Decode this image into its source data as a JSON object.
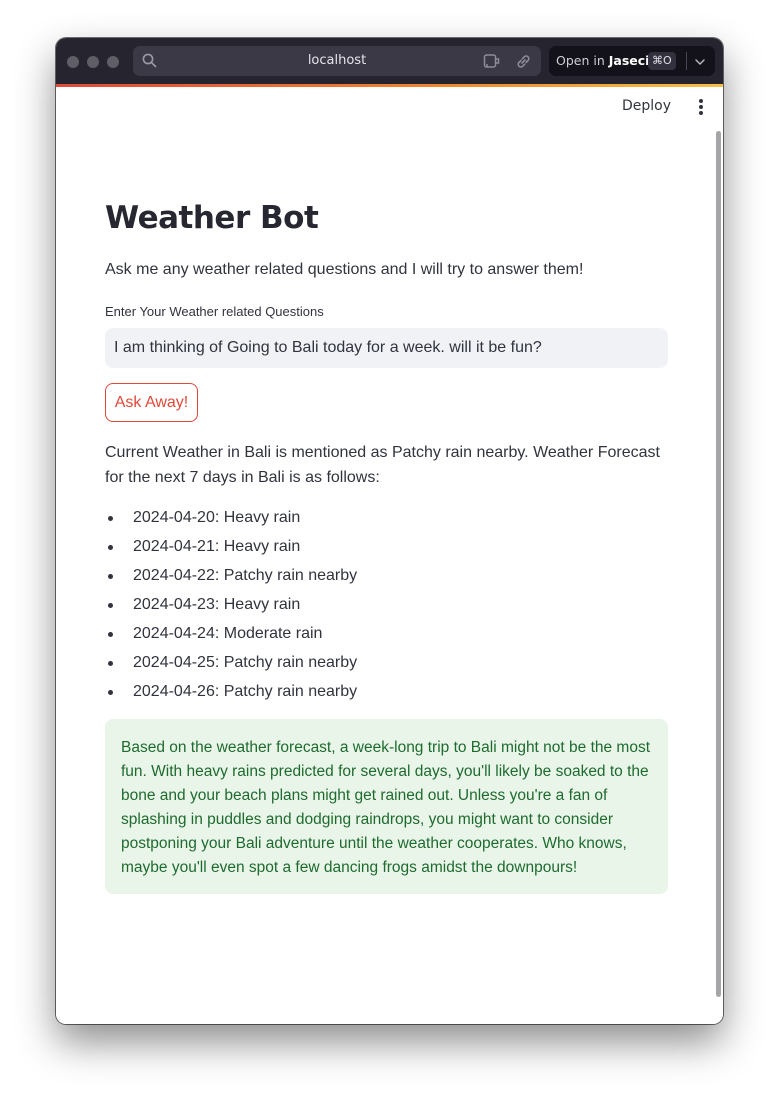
{
  "browser": {
    "url": "localhost",
    "open_in_label": "Open in",
    "open_in_brand": "Jaseci",
    "open_in_shortcut": "⌘O"
  },
  "app": {
    "deploy_label": "Deploy",
    "title": "Weather Bot",
    "subtitle": "Ask me any weather related questions and I will try to answer them!",
    "input_label": "Enter Your Weather related Questions",
    "input_value": "I am thinking of Going to Bali today for a week. will it be fun?",
    "ask_button": "Ask Away!"
  },
  "response": {
    "intro": "Current Weather in Bali is mentioned as Patchy rain nearby. Weather Forecast for the next 7 days in Bali is as follows:",
    "forecast": [
      "2024-04-20: Heavy rain",
      "2024-04-21: Heavy rain",
      "2024-04-22: Patchy rain nearby",
      "2024-04-23: Heavy rain",
      "2024-04-24: Moderate rain",
      "2024-04-25: Patchy rain nearby",
      "2024-04-26: Patchy rain nearby"
    ],
    "verdict": "Based on the weather forecast, a week-long trip to Bali might not be the most fun. With heavy rains predicted for several days, you'll likely be soaked to the bone and your beach plans might get rained out. Unless you're a fan of splashing in puddles and dodging raindrops, you might want to consider postponing your Bali adventure until the weather cooperates. Who knows, maybe you'll even spot a few dancing frogs amidst the downpours!"
  },
  "colors": {
    "accent": "#e0493a",
    "success_bg": "#eaf5ea",
    "success_text": "#1e6b2e",
    "input_bg": "#f0f2f6"
  },
  "icons": [
    "search-icon",
    "extension-icon",
    "link-icon",
    "chevron-down-icon",
    "kebab-menu-icon"
  ]
}
